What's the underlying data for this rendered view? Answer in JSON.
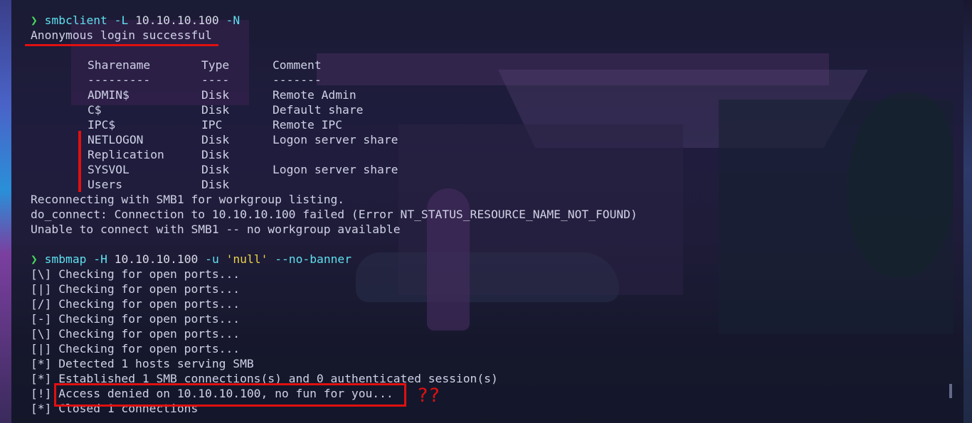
{
  "terminal": {
    "smbclient": {
      "prompt": "❯",
      "command": "smbclient",
      "flag_list": "-L",
      "host": "10.10.10.100",
      "flag_nopass": "-N",
      "login_result": "Anonymous login successful",
      "table": {
        "headers": [
          "Sharename",
          "Type",
          "Comment"
        ],
        "separators": [
          "---------",
          "----",
          "-------"
        ],
        "rows": [
          [
            "ADMIN$",
            "Disk",
            "Remote Admin"
          ],
          [
            "C$",
            "Disk",
            "Default share"
          ],
          [
            "IPC$",
            "IPC",
            "Remote IPC"
          ],
          [
            "NETLOGON",
            "Disk",
            "Logon server share"
          ],
          [
            "Replication",
            "Disk",
            ""
          ],
          [
            "SYSVOL",
            "Disk",
            "Logon server share"
          ],
          [
            "Users",
            "Disk",
            ""
          ]
        ]
      },
      "output_lines": [
        "Reconnecting with SMB1 for workgroup listing.",
        "do_connect: Connection to 10.10.10.100 failed (Error NT_STATUS_RESOURCE_NAME_NOT_FOUND)",
        "Unable to connect with SMB1 -- no workgroup available"
      ]
    },
    "smbmap": {
      "prompt": "❯",
      "command": "smbmap",
      "flag_host": "-H",
      "host": "10.10.10.100",
      "flag_user": "-u",
      "user": "'null'",
      "flag_banner": "--no-banner",
      "output_lines": [
        "[\\] Checking for open ports...",
        "[|] Checking for open ports...",
        "[/] Checking for open ports...",
        "[-] Checking for open ports...",
        "[\\] Checking for open ports...",
        "[|] Checking for open ports...",
        "[*] Detected 1 hosts serving SMB",
        "[*] Established 1 SMB connections(s) and 0 authenticated session(s)",
        "[!] Access denied on 10.10.10.100, no fun for you...",
        "[*] Closed 1 connections"
      ]
    },
    "annotation_text": "??"
  },
  "colors": {
    "prompt": "#46d95b",
    "command": "#5fe0ee",
    "string": "#e8d24a",
    "text": "#cfd2e6",
    "annotation": "#e01010"
  }
}
